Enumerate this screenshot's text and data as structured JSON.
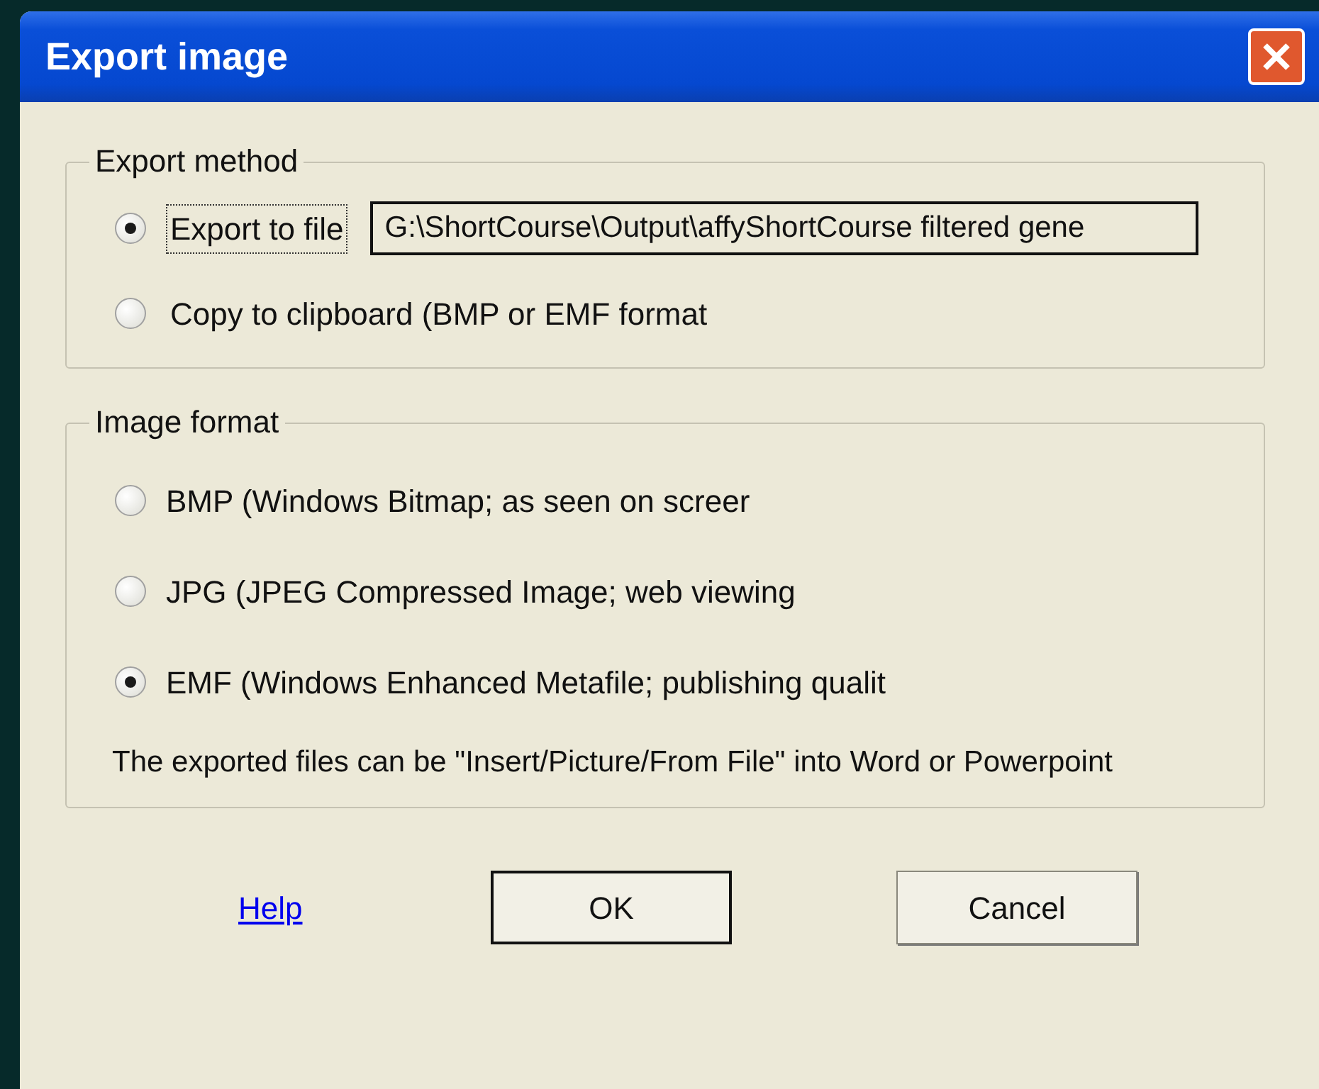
{
  "window": {
    "title": "Export image"
  },
  "export_method": {
    "title": "Export method",
    "options": [
      {
        "label": "Export to file",
        "selected": true,
        "focused": true,
        "field": {
          "value": "G:\\ShortCourse\\Output\\affyShortCourse filtered gene"
        }
      },
      {
        "label": "Copy to clipboard (BMP or EMF format",
        "selected": false,
        "focused": false
      }
    ]
  },
  "image_format": {
    "title": "Image format",
    "options": [
      {
        "label": "BMP (Windows Bitmap; as seen on screer",
        "selected": false
      },
      {
        "label": "JPG (JPEG Compressed Image; web viewing",
        "selected": false
      },
      {
        "label": "EMF (Windows Enhanced Metafile; publishing qualit",
        "selected": true
      }
    ],
    "note": "The exported files can be \"Insert/Picture/From File\" into Word or Powerpoint"
  },
  "buttons": {
    "help": "Help",
    "ok": "OK",
    "cancel": "Cancel"
  }
}
